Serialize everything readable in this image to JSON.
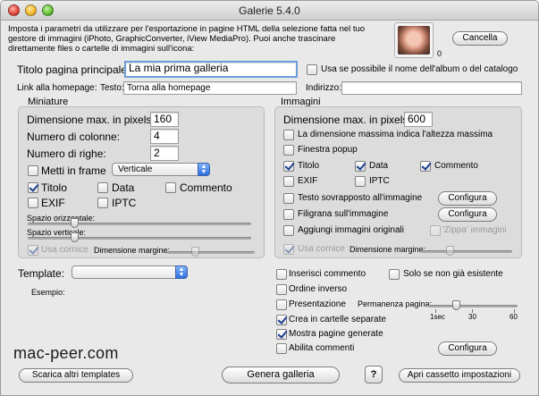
{
  "window": {
    "title": "Galerie 5.4.0"
  },
  "intro": {
    "text": "Imposta i parametri da utilizzare per l'esportazione in pagine HTML della selezione fatta nel tuo gestore di immagini (iPhoto, GraphicConverter, iView MediaPro). Puoi anche trascinare direttamente files o cartelle di immagini sull'icona:"
  },
  "icon_well": {
    "count": "0"
  },
  "buttons": {
    "cancel": "Cancella",
    "download_templates": "Scarica altri templates",
    "generate": "Genera galleria",
    "help": "?",
    "open_drawer": "Apri cassetto impostazioni",
    "configure": "Configura"
  },
  "title_page": {
    "label": "Titolo pagina principale:",
    "value": "La mia prima galleria",
    "use_album_name": "Usa se possibile il nome dell'album o del catalogo"
  },
  "homepage": {
    "label": "Link alla homepage:",
    "text_label": "Testo:",
    "text_value": "Torna alla homepage",
    "address_label": "Indirizzo:",
    "address_value": ""
  },
  "thumbnails": {
    "title": "Miniature",
    "max_size_label": "Dimensione max. in pixels:",
    "max_size_value": "160",
    "columns_label": "Numero di colonne:",
    "columns_value": "4",
    "rows_label": "Numero di righe:",
    "rows_value": "2",
    "frame_label": "Metti in frame",
    "frame_orientation": "Verticale",
    "cb_title": "Titolo",
    "cb_date": "Data",
    "cb_comment": "Commento",
    "cb_exif": "EXIF",
    "cb_iptc": "IPTC",
    "h_spacing_label": "Spazio orizzontale:",
    "v_spacing_label": "Spazio verticale:",
    "use_frame_label": "Usa cornice",
    "margin_label": "Dimensione margine:",
    "h_spacing": 0.2,
    "v_spacing": 0.2,
    "margin": 0.3
  },
  "images": {
    "title": "Immagini",
    "max_size_label": "Dimensione max. in pixels:",
    "max_size_value": "600",
    "max_height_label": "La dimensione massima indica l'altezza massima",
    "popup_label": "Finestra popup",
    "cb_title": "Titolo",
    "cb_date": "Data",
    "cb_comment": "Commento",
    "cb_exif": "EXIF",
    "cb_iptc": "IPTC",
    "overlay_text_label": "Testo sovrapposto all'immagine",
    "watermark_label": "Filigrana sull'immagine",
    "add_originals_label": "Aggiungi immagini originali",
    "zip_label": "'Zippa' immagini",
    "use_frame_label": "Usa cornice",
    "margin_label": "Dimensione margine:",
    "margin": 0.3
  },
  "template": {
    "label": "Template:",
    "value": "",
    "example_label": "Esempio:"
  },
  "options": {
    "insert_comment": "Inserisci commento",
    "only_if_missing": "Solo se non già esistente",
    "reverse_order": "Ordine inverso",
    "presentation": "Presentazione",
    "page_duration_label": "Permanenza pagina:",
    "duration_ticks": [
      "1sec",
      "30",
      "60"
    ],
    "page_duration": 0.3,
    "separate_folders": "Crea in cartelle separate",
    "show_pages": "Mostra pagine generate",
    "enable_comments": "Abilita commenti"
  },
  "watermark": "mac-peer.com"
}
